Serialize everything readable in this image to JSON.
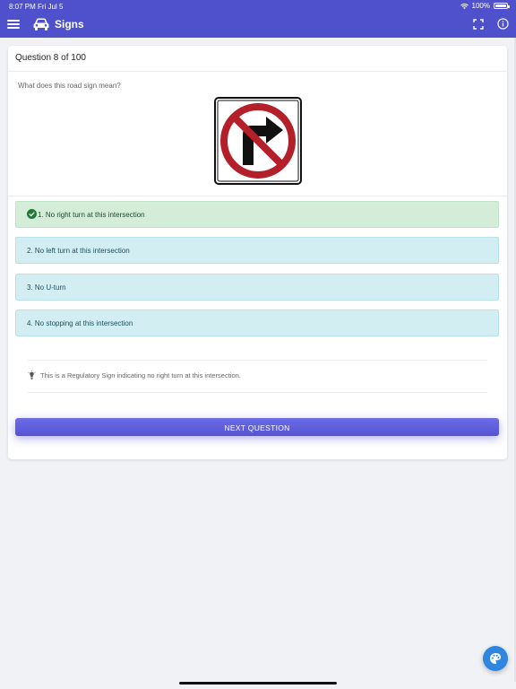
{
  "status_bar": {
    "time": "8:07 PM",
    "date": "Fri Jul 5",
    "battery": "100%"
  },
  "app_bar": {
    "title": "Signs",
    "menu_icon": "hamburger-menu-icon",
    "brand_icon": "car-icon",
    "fullscreen_icon": "fullscreen-icon",
    "info_icon": "info-icon",
    "color": "#4f51cc"
  },
  "quiz": {
    "header": "Question 8 of 100",
    "prompt": "What does this road sign mean?",
    "sign_icon": "no-right-turn-sign",
    "answers": [
      {
        "label": "1. No right turn at this intersection",
        "state": "correct"
      },
      {
        "label": "2. No left turn at this intersection",
        "state": "neutral"
      },
      {
        "label": "3. No U-turn",
        "state": "neutral"
      },
      {
        "label": "4. No stopping at this intersection",
        "state": "neutral"
      }
    ],
    "explanation": "This is a Regulatory Sign indicating no right turn at this intersection.",
    "next_button": "NEXT QUESTION"
  },
  "colors": {
    "correct_bg": "#d4edd9",
    "neutral_bg": "#d2eef2",
    "check": "#1e7b34",
    "fab": "#2e86de"
  },
  "fab_icon": "palette-icon"
}
